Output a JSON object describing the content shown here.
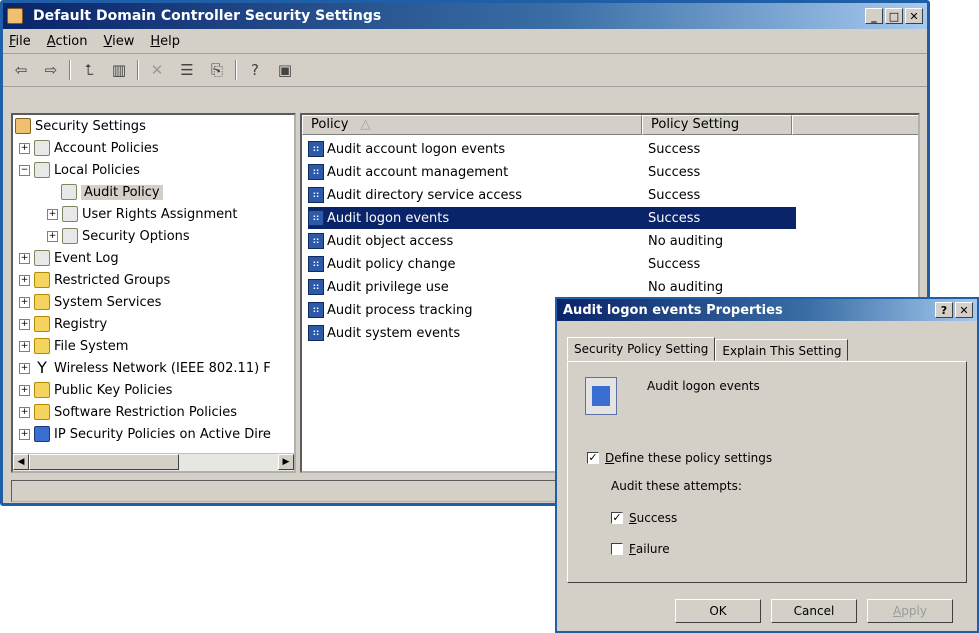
{
  "main_window": {
    "title": "Default Domain Controller Security Settings",
    "menu": [
      {
        "label": "File",
        "accel": "F",
        "rest": "ile"
      },
      {
        "label": "Action",
        "accel": "A",
        "rest": "ction"
      },
      {
        "label": "View",
        "accel": "V",
        "rest": "iew"
      },
      {
        "label": "Help",
        "accel": "H",
        "rest": "elp"
      }
    ],
    "toolbar": {
      "back_glyph": "⇦",
      "forward_glyph": "⇨",
      "up_glyph": "⮤",
      "showhide_glyph": "▥",
      "delete_glyph": "✕",
      "properties_glyph": "☰",
      "export_glyph": "⎘",
      "help_glyph": "?",
      "extra_glyph": "▣"
    },
    "tree": {
      "items": [
        {
          "label": "Security Settings"
        },
        {
          "label": "Account Policies"
        },
        {
          "label": "Local Policies"
        },
        {
          "label": "Audit Policy"
        },
        {
          "label": "User Rights Assignment"
        },
        {
          "label": "Security Options"
        },
        {
          "label": "Event Log"
        },
        {
          "label": "Restricted Groups"
        },
        {
          "label": "System Services"
        },
        {
          "label": "Registry"
        },
        {
          "label": "File System"
        },
        {
          "label": "Wireless Network (IEEE 802.11) F"
        },
        {
          "label": "Public Key Policies"
        },
        {
          "label": "Software Restriction Policies"
        },
        {
          "label": "IP Security Policies on Active Dire"
        }
      ]
    },
    "list": {
      "columns": [
        "Policy",
        "Policy Setting"
      ],
      "sort_indicator": "△",
      "rows": [
        {
          "policy": "Audit account logon events",
          "setting": "Success"
        },
        {
          "policy": "Audit account management",
          "setting": "Success"
        },
        {
          "policy": "Audit directory service access",
          "setting": "Success"
        },
        {
          "policy": "Audit logon events",
          "setting": "Success"
        },
        {
          "policy": "Audit object access",
          "setting": "No auditing"
        },
        {
          "policy": "Audit policy change",
          "setting": "Success"
        },
        {
          "policy": "Audit privilege use",
          "setting": "No auditing"
        },
        {
          "policy": "Audit process tracking",
          "setting": ""
        },
        {
          "policy": "Audit system events",
          "setting": ""
        }
      ],
      "selected_index": 3
    }
  },
  "dialog": {
    "title": "Audit logon events Properties",
    "tabs": [
      "Security Policy Setting",
      "Explain This Setting"
    ],
    "policy_name": "Audit logon events",
    "define_label_accel": "D",
    "define_label_rest": "efine these policy settings",
    "define_checked": true,
    "attempts_label": "Audit these attempts:",
    "success_accel": "S",
    "success_rest": "uccess",
    "success_checked": true,
    "failure_accel": "F",
    "failure_rest": "ailure",
    "failure_checked": false,
    "buttons": {
      "ok": "OK",
      "cancel": "Cancel",
      "apply_accel": "A",
      "apply_rest": "pply"
    },
    "help_glyph": "?",
    "close_glyph": "✕"
  }
}
